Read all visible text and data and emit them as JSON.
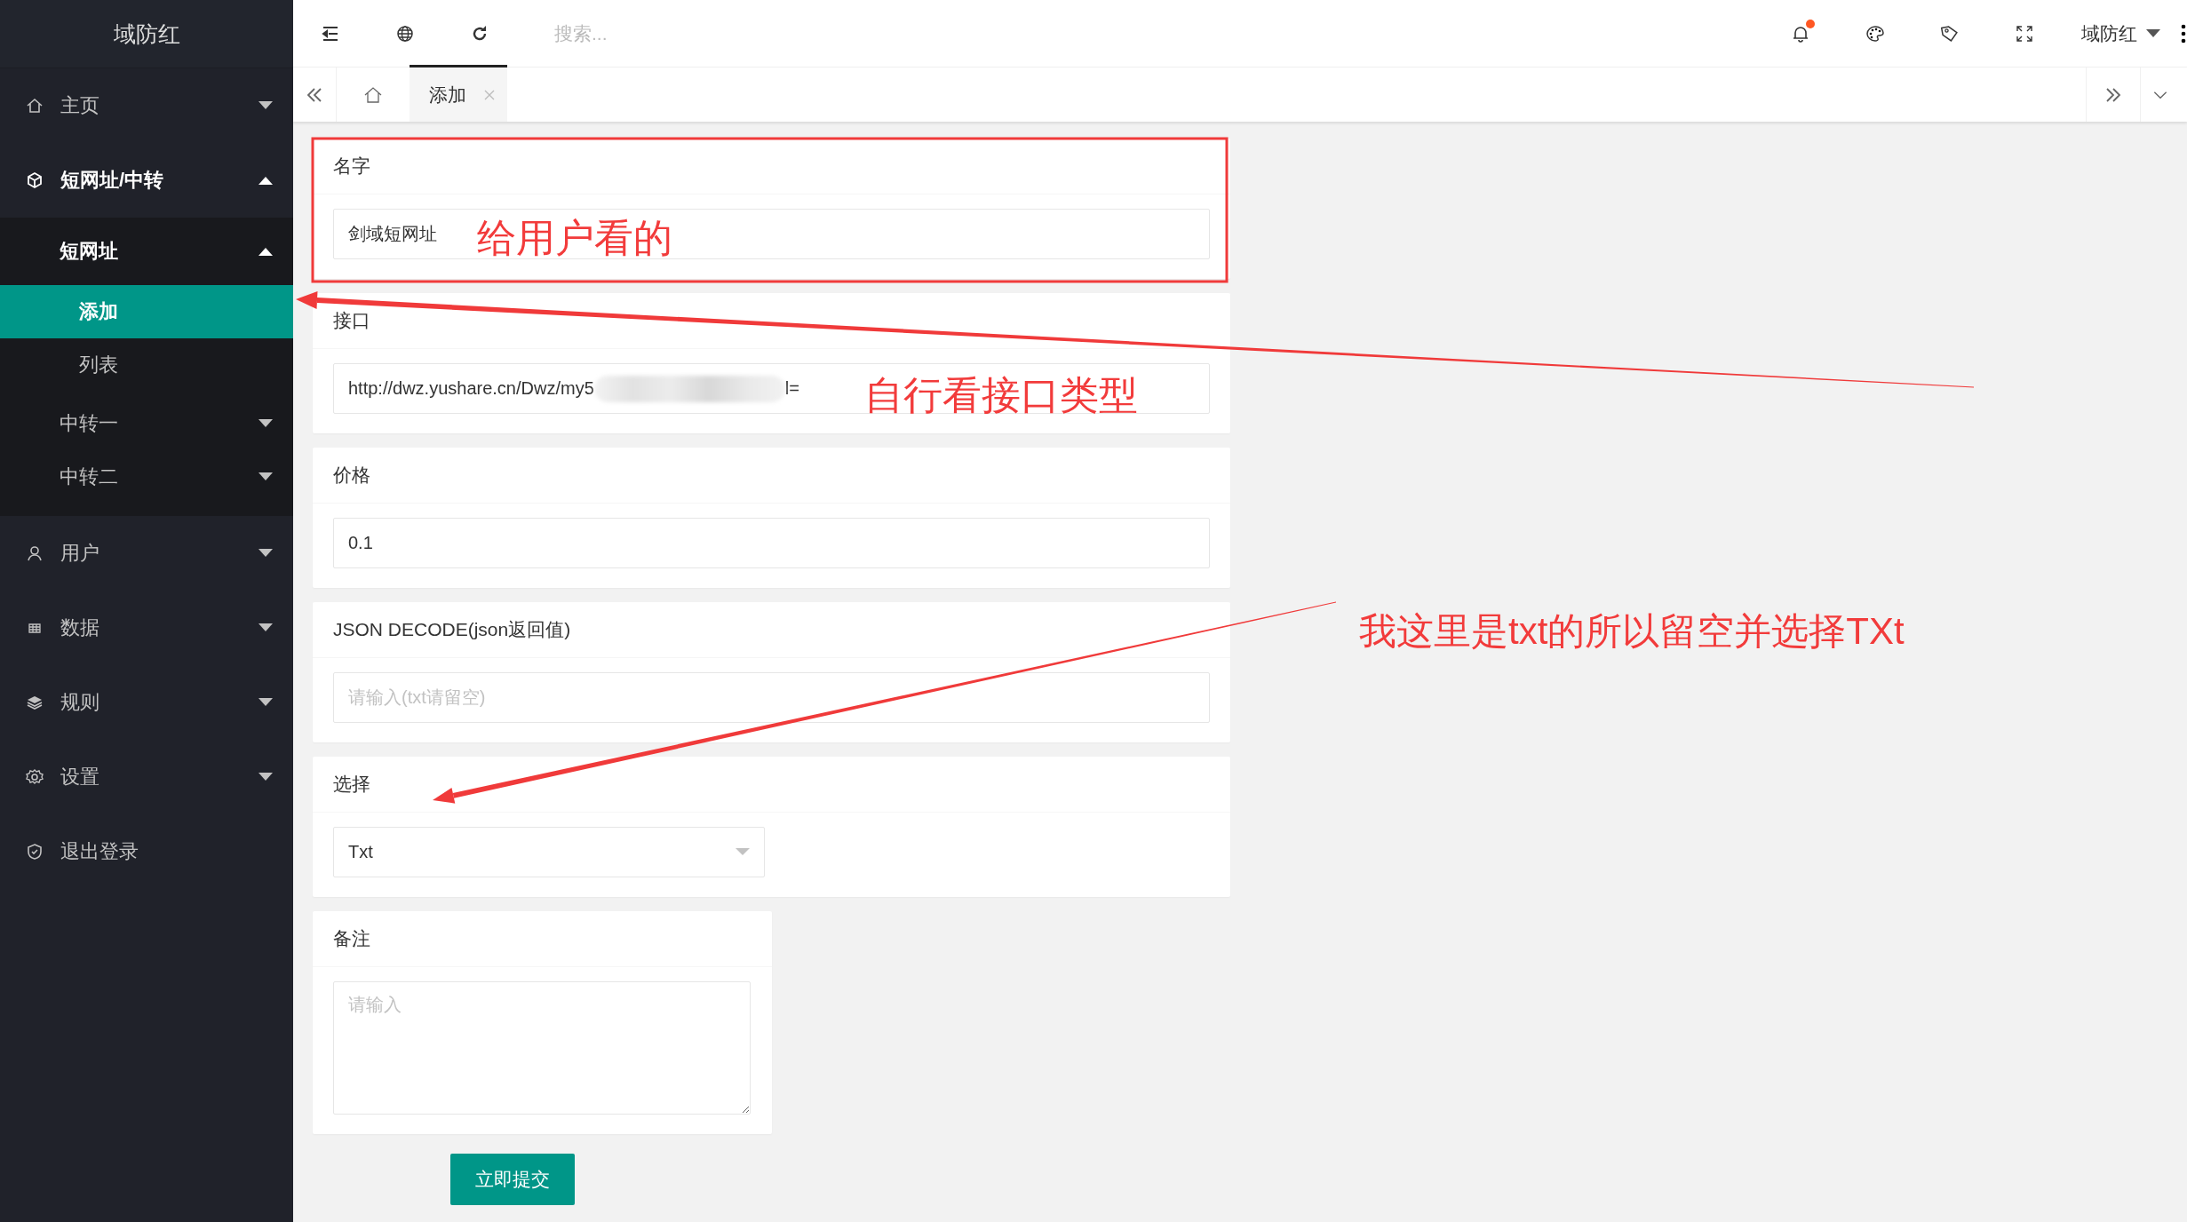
{
  "sidebar": {
    "title": "域防红",
    "items": [
      {
        "label": "主页",
        "expanded": false
      },
      {
        "label": "短网址/中转",
        "expanded": true,
        "children": [
          {
            "label": "短网址",
            "expanded": true,
            "children": [
              {
                "label": "添加",
                "selected": true
              },
              {
                "label": "列表",
                "selected": false
              }
            ]
          },
          {
            "label": "中转一",
            "expanded": false
          },
          {
            "label": "中转二",
            "expanded": false
          }
        ]
      },
      {
        "label": "用户",
        "expanded": false
      },
      {
        "label": "数据",
        "expanded": false
      },
      {
        "label": "规则",
        "expanded": false
      },
      {
        "label": "设置",
        "expanded": false
      },
      {
        "label": "退出登录"
      }
    ]
  },
  "header": {
    "search": {
      "placeholder": "搜索..."
    },
    "notification": true,
    "user": "域防红"
  },
  "tabs": [
    {
      "label": "添加",
      "selected": true
    }
  ],
  "form": {
    "fields": [
      {
        "kind": "text",
        "label": "名字",
        "value": "剑域短网址"
      },
      {
        "kind": "redacted",
        "label": "接口",
        "value_start": "http://dwz.yushare.cn/Dwz/my5",
        "value_end": "l="
      },
      {
        "kind": "text",
        "label": "价格",
        "value": "0.1"
      },
      {
        "kind": "text",
        "label": "JSON DECODE(json返回值)",
        "placeholder": "请输入(txt请留空)"
      },
      {
        "kind": "select",
        "label": "选择",
        "value": "Txt"
      },
      {
        "kind": "textarea",
        "label": "备注",
        "placeholder": "请输入"
      }
    ],
    "submit": "立即提交"
  },
  "annotations": [
    "给用户看的",
    "自行看接口类型",
    "我这里是txt的所以留空并选择TXt"
  ]
}
